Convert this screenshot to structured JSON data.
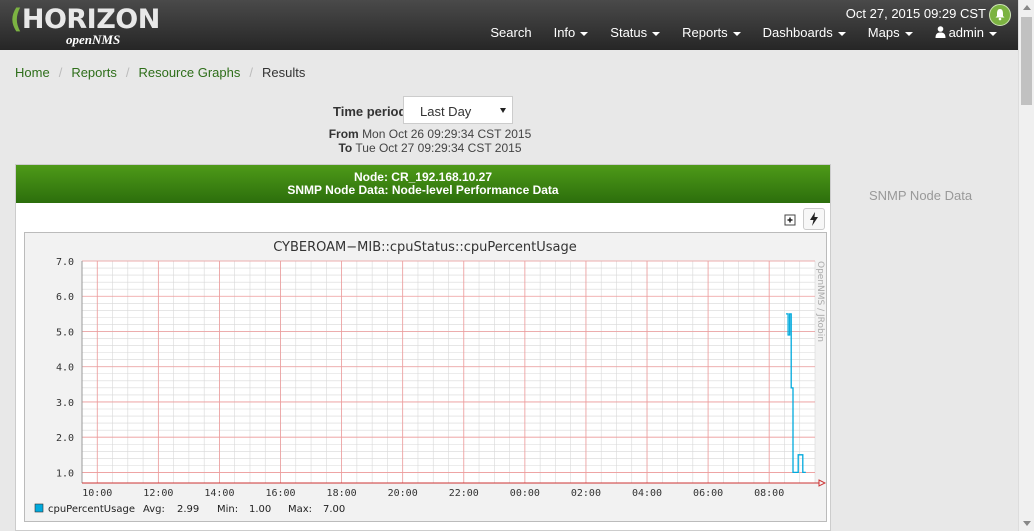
{
  "header": {
    "logo_text": "HORIZON",
    "logo_sub": "openNMS",
    "datetime": "Oct 27, 2015 09:29 CST",
    "menu": [
      {
        "label": "Search",
        "dropdown": false
      },
      {
        "label": "Info",
        "dropdown": true
      },
      {
        "label": "Status",
        "dropdown": true
      },
      {
        "label": "Reports",
        "dropdown": true
      },
      {
        "label": "Dashboards",
        "dropdown": true
      },
      {
        "label": "Maps",
        "dropdown": true
      },
      {
        "label": "admin",
        "dropdown": true,
        "icon": "user-icon"
      }
    ],
    "notification_icon": "bell-icon",
    "accent": "#7cb342"
  },
  "breadcrumb": {
    "items": [
      "Home",
      "Reports",
      "Resource Graphs"
    ],
    "current": "Results"
  },
  "time_period": {
    "label": "Time period",
    "selected": "Last Day",
    "from_label": "From",
    "from_value": "Mon Oct 26 09:29:34 CST 2015",
    "to_label": "To",
    "to_value": "Tue Oct 27 09:29:34 CST 2015"
  },
  "panel": {
    "node_line": "Node: CR_192.168.10.27",
    "subtitle": "SNMP Node Data: Node-level Performance Data",
    "heading_color": "#3a8a12",
    "zoom_icon": "zoom-icon",
    "bolt_icon": "bolt-icon"
  },
  "side_label": "SNMP Node Data",
  "chart_data": {
    "type": "line",
    "title": "CYBEROAM−MIB::cpuStatus::cpuPercentUsage",
    "watermark": "OpenNMS / JRobin",
    "x_ticks": [
      "10:00",
      "12:00",
      "14:00",
      "16:00",
      "18:00",
      "20:00",
      "22:00",
      "00:00",
      "02:00",
      "04:00",
      "06:00",
      "08:00"
    ],
    "y_ticks": [
      "1.0",
      "2.0",
      "3.0",
      "4.0",
      "5.0",
      "6.0",
      "7.0"
    ],
    "ylim": [
      0.7,
      7.0
    ],
    "xlim_hours": [
      9.5,
      33.5
    ],
    "grid": true,
    "line_color": "#00aadd",
    "series": [
      {
        "name": "cpuPercentUsage",
        "points": [
          [
            32.55,
            5.5
          ],
          [
            32.62,
            5.5
          ],
          [
            32.62,
            4.9
          ],
          [
            32.67,
            4.9
          ],
          [
            32.67,
            5.5
          ],
          [
            32.72,
            5.5
          ],
          [
            32.72,
            3.4
          ],
          [
            32.78,
            3.4
          ],
          [
            32.78,
            1.0
          ],
          [
            32.95,
            1.0
          ],
          [
            32.95,
            1.5
          ],
          [
            33.1,
            1.5
          ],
          [
            33.1,
            1.0
          ],
          [
            33.2,
            1.0
          ]
        ]
      }
    ],
    "legend": {
      "name": "cpuPercentUsage",
      "avg_label": "Avg:",
      "avg": "2.99",
      "min_label": "Min:",
      "min": "1.00",
      "max_label": "Max:",
      "max": "7.00"
    }
  }
}
